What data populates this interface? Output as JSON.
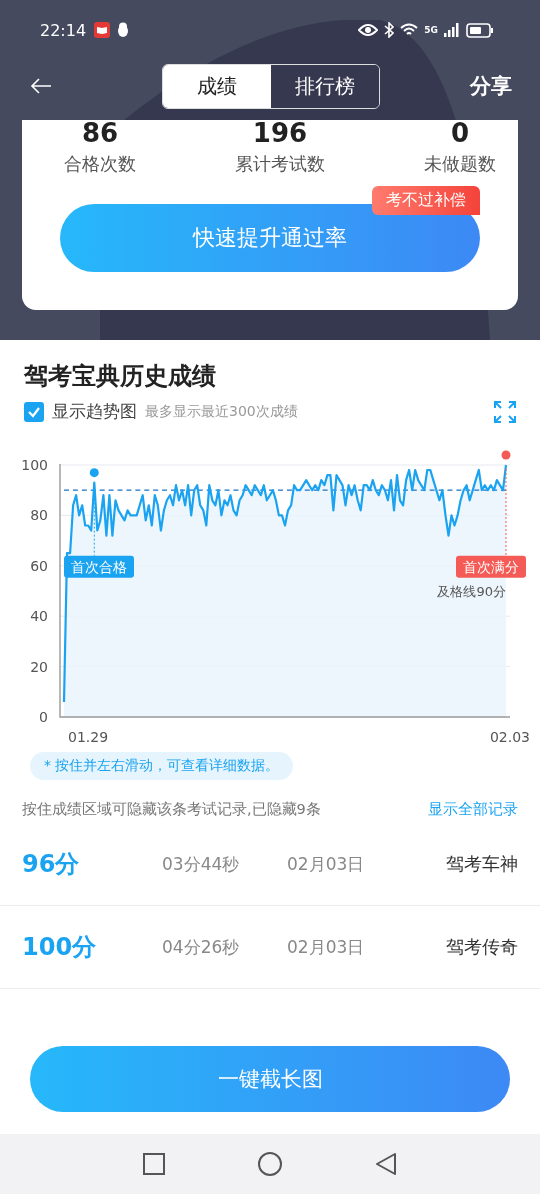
{
  "status_bar": {
    "time": "22:14",
    "network": "5G"
  },
  "header": {
    "tabs": [
      {
        "label": "成绩",
        "selected": true
      },
      {
        "label": "排行榜",
        "selected": false
      }
    ],
    "share": "分享"
  },
  "stats": [
    {
      "value": "86",
      "label": "合格次数"
    },
    {
      "value": "196",
      "label": "累计考试数"
    },
    {
      "value": "0",
      "label": "未做题数"
    }
  ],
  "boost_button": {
    "label": "快速提升通过率",
    "badge": "考不过补偿"
  },
  "history": {
    "title": "驾考宝典历史成绩",
    "trend_checkbox": {
      "label": "显示趋势图",
      "checked": true
    },
    "hint": "最多显示最近300次成绩",
    "date_range": {
      "start": "01.29",
      "end": "02.03"
    },
    "chart_data": {
      "type": "line",
      "grid": true,
      "yticks": [
        0,
        20,
        40,
        60,
        80,
        100
      ],
      "ylim": [
        0,
        100
      ],
      "series": [
        {
          "color": "#1aa3f0",
          "values": [
            6,
            65,
            65,
            84,
            88,
            80,
            84,
            76,
            76,
            74,
            93,
            74,
            78,
            88,
            72,
            88,
            72,
            86,
            82,
            80,
            78,
            82,
            80,
            80,
            80,
            84,
            88,
            78,
            84,
            76,
            88,
            84,
            74,
            82,
            86,
            88,
            84,
            92,
            86,
            90,
            84,
            92,
            80,
            90,
            92,
            84,
            82,
            76,
            92,
            86,
            84,
            90,
            80,
            86,
            84,
            88,
            82,
            80,
            86,
            88,
            92,
            90,
            88,
            92,
            90,
            88,
            92,
            86,
            88,
            90,
            86,
            80,
            80,
            76,
            82,
            84,
            92,
            90,
            90,
            92,
            94,
            92,
            90,
            92,
            90,
            94,
            92,
            96,
            96,
            82,
            96,
            94,
            92,
            84,
            92,
            88,
            92,
            86,
            82,
            92,
            92,
            90,
            94,
            90,
            88,
            92,
            90,
            86,
            94,
            82,
            96,
            86,
            84,
            94,
            98,
            90,
            98,
            94,
            92,
            90,
            98,
            98,
            94,
            90,
            86,
            90,
            80,
            72,
            80,
            76,
            80,
            86,
            90,
            92,
            86,
            90,
            94,
            98,
            90,
            92,
            90,
            92,
            90,
            94,
            92,
            90,
            100
          ]
        },
        {
          "name": "及格线90分",
          "color": "#1a73c8",
          "line_style": "dashed",
          "values": [
            90,
            90,
            90,
            90,
            90,
            90,
            90,
            90,
            90,
            90,
            90,
            90,
            90,
            90,
            90,
            90,
            90,
            90,
            90,
            90,
            90,
            90,
            90,
            90,
            90,
            90,
            90,
            90,
            90,
            90,
            90,
            90,
            90,
            90,
            90,
            90,
            90,
            90,
            90,
            90,
            90,
            90,
            90,
            90,
            90,
            90,
            90,
            90,
            90,
            90,
            90,
            90,
            90,
            90,
            90,
            90,
            90,
            90,
            90,
            90,
            90,
            90,
            90,
            90,
            90,
            90,
            90,
            90,
            90,
            90,
            90,
            90,
            90,
            90,
            90,
            90,
            90,
            90,
            90,
            90,
            90,
            90,
            90,
            90,
            90,
            90,
            90,
            90,
            90,
            90,
            90,
            90,
            90,
            90,
            90,
            90,
            90,
            90,
            90,
            90,
            90,
            90,
            90,
            90,
            90,
            90,
            90,
            90,
            90,
            90,
            90,
            90,
            90,
            90,
            90,
            90,
            90,
            90,
            90,
            90,
            90,
            90,
            90,
            90,
            90,
            90,
            90,
            90,
            90,
            90,
            90,
            90,
            90,
            90,
            90,
            90,
            90,
            90,
            90,
            90,
            90,
            90,
            90,
            90,
            90,
            90,
            90
          ]
        }
      ],
      "annotations": [
        "首次合格",
        "首次满分"
      ]
    },
    "tip": "* 按住并左右滑动，可查看详细数据。",
    "hidden_note": "按住成绩区域可隐藏该条考试记录,已隐藏9条",
    "show_all_link": "显示全部记录"
  },
  "records": [
    {
      "score": "96分",
      "duration": "03分44秒",
      "date": "02月03日",
      "title": "驾考车神"
    },
    {
      "score": "100分",
      "duration": "04分26秒",
      "date": "02月03日",
      "title": "驾考传奇"
    }
  ],
  "screenshot_button": "一键截长图"
}
